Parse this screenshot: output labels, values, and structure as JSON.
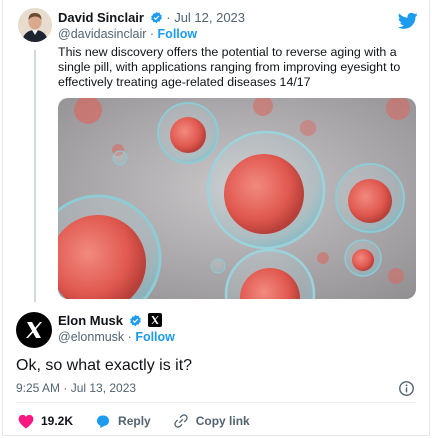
{
  "quoted_tweet": {
    "author_name": "David Sinclair",
    "date": "Jul 12, 2023",
    "separator": "·",
    "handle": "@davidasinclair",
    "follow_label": "Follow",
    "text": "This new discovery offers the potential to reverse aging with a single pill, with applications ranging from improving eyesight to effectively treating age-related diseases 14/17",
    "image": "cells-microscopy-image"
  },
  "reply_tweet": {
    "author_name": "Elon Musk",
    "handle": "@elonmusk",
    "separator": "·",
    "follow_label": "Follow",
    "text": "Ok, so what exactly is it?",
    "timestamp": "9:25 AM · Jul 13, 2023"
  },
  "actions": {
    "like_count": "19.2K",
    "reply_label": "Reply",
    "copy_link_label": "Copy link"
  },
  "colors": {
    "accent": "#1d9bf0",
    "like": "#f91880",
    "verified": "#1d9bf0",
    "secondary_text": "#536471"
  },
  "icons": [
    "twitter-bird-icon",
    "verified-badge-icon",
    "x-logo-icon",
    "info-icon",
    "heart-icon",
    "reply-icon",
    "link-icon"
  ]
}
